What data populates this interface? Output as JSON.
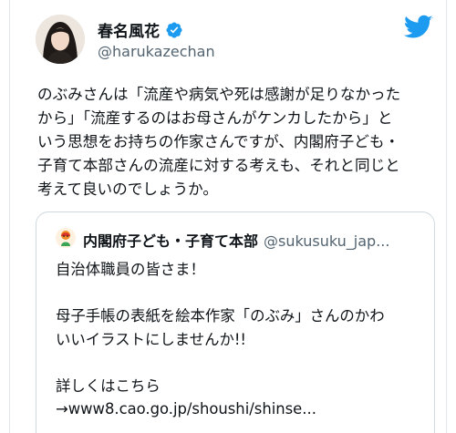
{
  "tweet": {
    "author_name": "春名風花",
    "author_handle": "@harukazechan",
    "verified_icon": "verified-badge-icon",
    "brand_icon": "twitter-bird-icon",
    "text_lines": [
      "のぶみさんは「流産や病気や死は感謝が足りなかった",
      "から」「流産するのはお母さんがケンカしたから」と",
      "いう思想をお持ちの作家さんですが、内閣府子ども・",
      "子育て本部さんの流産に対する考えも、それと同じと",
      "考えて良いのでしょうか。"
    ]
  },
  "quote": {
    "author_name": "内閣府子ども・子育て本部",
    "author_handle": "@sukusuku_jap...",
    "text_lines": [
      "自治体職員の皆さま！",
      "",
      "母子手帳の表紙を絵本作家「のぶみ」さんのかわ",
      "いいイラストにしませんか!!",
      "",
      "詳しくはこちら",
      "→www8.cao.go.jp/shoushi/shinse..."
    ]
  },
  "colors": {
    "twitter_blue": "#1d9bf0",
    "text_primary": "#0f1419",
    "text_secondary": "#536471",
    "border": "#cfd9de"
  }
}
